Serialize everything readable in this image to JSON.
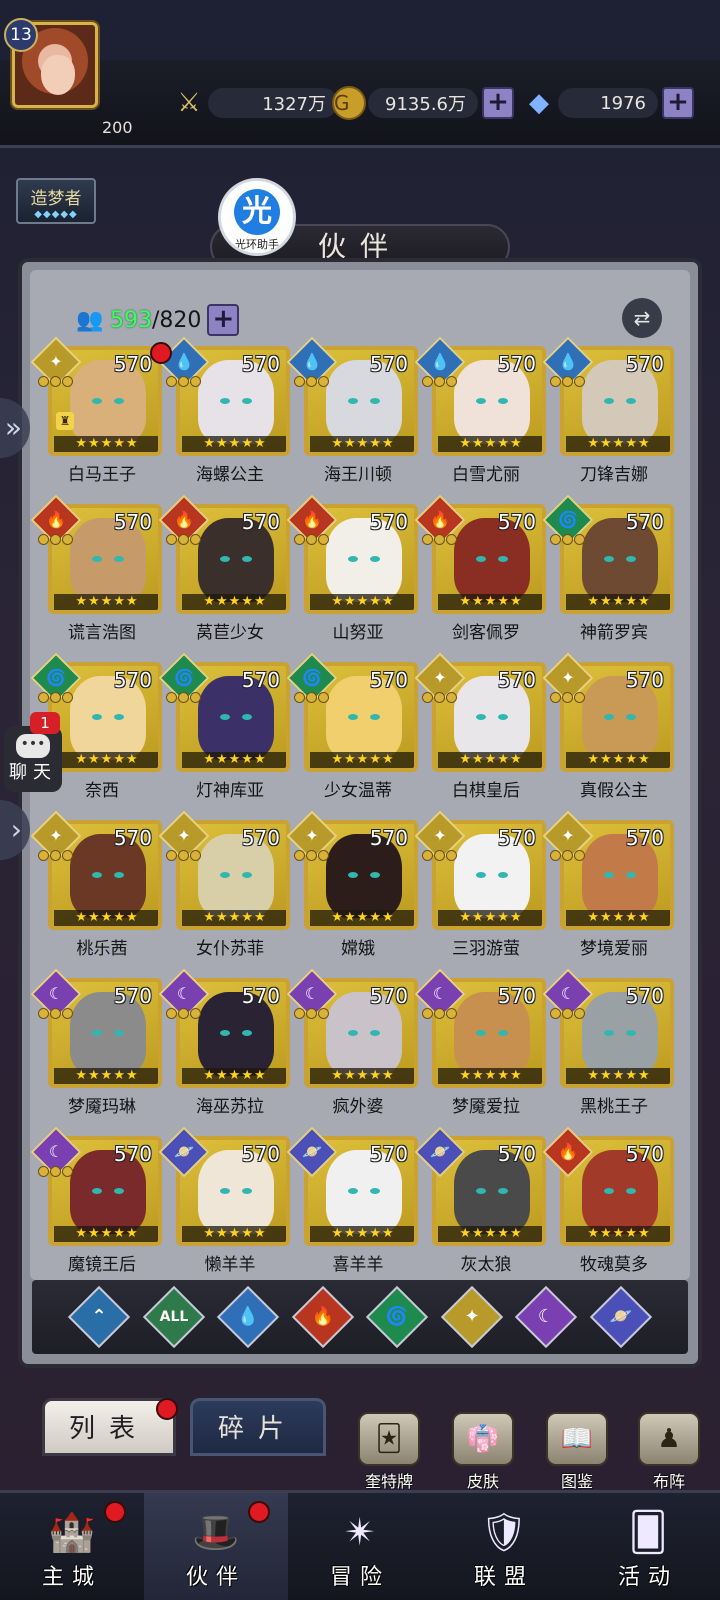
{
  "player": {
    "level": "13",
    "sub_value": "200",
    "rank_title": "造梦者",
    "rank_stars": "◆◆◆◆◆"
  },
  "resources": {
    "power": {
      "icon": "sword-icon",
      "value": "1327万"
    },
    "gold": {
      "icon": "gold-coin-icon",
      "value": "9135.6万"
    },
    "diamond": {
      "icon": "diamond-icon",
      "value": "1976"
    },
    "plus_label": "+"
  },
  "helper": {
    "icon_text": "光",
    "label": "光环助手"
  },
  "panel": {
    "title": "伙伴",
    "count_current": "593",
    "count_separator": "/",
    "count_max": "820",
    "plus_label": "+"
  },
  "heroes": [
    {
      "name": "白马王子",
      "level": "570",
      "element": "light",
      "stars": "★★★★★",
      "dots": 3,
      "red_dot": true,
      "lock": true
    },
    {
      "name": "海螺公主",
      "level": "570",
      "element": "water",
      "stars": "★★★★★",
      "dots": 3
    },
    {
      "name": "海王川顿",
      "level": "570",
      "element": "water",
      "stars": "★★★★★",
      "dots": 3
    },
    {
      "name": "白雪尤丽",
      "level": "570",
      "element": "water",
      "stars": "★★★★★",
      "dots": 3
    },
    {
      "name": "刀锋吉娜",
      "level": "570",
      "element": "water",
      "stars": "★★★★★",
      "dots": 3
    },
    {
      "name": "谎言浩图",
      "level": "570",
      "element": "fire",
      "stars": "★★★★★",
      "dots": 3
    },
    {
      "name": "莴苣少女",
      "level": "570",
      "element": "fire",
      "stars": "★★★★★",
      "dots": 3
    },
    {
      "name": "山努亚",
      "level": "570",
      "element": "fire",
      "stars": "★★★★★",
      "dots": 3
    },
    {
      "name": "剑客佩罗",
      "level": "570",
      "element": "fire",
      "stars": "★★★★★",
      "dots": 3
    },
    {
      "name": "神箭罗宾",
      "level": "570",
      "element": "wind",
      "stars": "★★★★★",
      "dots": 3
    },
    {
      "name": "奈西",
      "level": "570",
      "element": "wind",
      "stars": "★★★★★",
      "dots": 3
    },
    {
      "name": "灯神库亚",
      "level": "570",
      "element": "wind",
      "stars": "★★★★★",
      "dots": 3
    },
    {
      "name": "少女温蒂",
      "level": "570",
      "element": "wind",
      "stars": "★★★★★",
      "dots": 3
    },
    {
      "name": "白棋皇后",
      "level": "570",
      "element": "light",
      "stars": "★★★★★",
      "dots": 3
    },
    {
      "name": "真假公主",
      "level": "570",
      "element": "light",
      "stars": "★★★★★",
      "dots": 3
    },
    {
      "name": "桃乐茜",
      "level": "570",
      "element": "light",
      "stars": "★★★★★",
      "dots": 3
    },
    {
      "name": "女仆苏菲",
      "level": "570",
      "element": "light",
      "stars": "★★★★★",
      "dots": 3
    },
    {
      "name": "嫦娥",
      "level": "570",
      "element": "light",
      "stars": "★★★★★",
      "dots": 3
    },
    {
      "name": "三羽游萤",
      "level": "570",
      "element": "light",
      "stars": "★★★★★",
      "dots": 3
    },
    {
      "name": "梦境爱丽",
      "level": "570",
      "element": "light",
      "stars": "★★★★★",
      "dots": 3
    },
    {
      "name": "梦魇玛琳",
      "level": "570",
      "element": "dark",
      "stars": "★★★★★",
      "dots": 3
    },
    {
      "name": "海巫苏拉",
      "level": "570",
      "element": "dark",
      "stars": "★★★★★",
      "dots": 3
    },
    {
      "name": "疯外婆",
      "level": "570",
      "element": "dark",
      "stars": "★★★★★",
      "dots": 3
    },
    {
      "name": "梦魇爱拉",
      "level": "570",
      "element": "dark",
      "stars": "★★★★★",
      "dots": 3
    },
    {
      "name": "黑桃王子",
      "level": "570",
      "element": "dark",
      "stars": "★★★★★",
      "dots": 3
    },
    {
      "name": "魔镜王后",
      "level": "570",
      "element": "dark",
      "stars": "★★★★★",
      "dots": 3
    },
    {
      "name": "懒羊羊",
      "level": "570",
      "element": "planet",
      "stars": "★★★★★",
      "dots": 0
    },
    {
      "name": "喜羊羊",
      "level": "570",
      "element": "planet",
      "stars": "★★★★★",
      "dots": 0
    },
    {
      "name": "灰太狼",
      "level": "570",
      "element": "planet",
      "stars": "★★★★★",
      "dots": 0
    },
    {
      "name": "牧魂莫多",
      "level": "570",
      "element": "fire",
      "stars": "★★★★★",
      "dots": 0
    }
  ],
  "element_styles": {
    "light": {
      "color": "#b89a2a",
      "glyph": "✦"
    },
    "water": {
      "color": "#2f6fb8",
      "glyph": "💧"
    },
    "fire": {
      "color": "#b8361f",
      "glyph": "🔥"
    },
    "wind": {
      "color": "#1f8a4e",
      "glyph": "🌀"
    },
    "dark": {
      "color": "#7a3fb0",
      "glyph": "☾"
    },
    "planet": {
      "color": "#4a50b8",
      "glyph": "🪐"
    }
  },
  "portrait_colors": [
    "#d9b07a",
    "#e7e1e8",
    "#d7d9de",
    "#f0e2d8",
    "#d4c9b8",
    "#c79a6a",
    "#3a2f2a",
    "#f1efe8",
    "#8a2d22",
    "#6e4a33",
    "#f0d69a",
    "#3b3168",
    "#f1cf6c",
    "#e9e6ea",
    "#c99a55",
    "#6a3825",
    "#d8cfa8",
    "#2c1d1a",
    "#f2f2f2",
    "#c27b48",
    "#8b8b8b",
    "#2a2333",
    "#c9c3c9",
    "#c8904e",
    "#9aa1a4",
    "#7a2a2a",
    "#efe6d7",
    "#f0f0f0",
    "#4a4a4a",
    "#a23a2a"
  ],
  "filters": [
    {
      "name": "filter-special",
      "label": "⌃",
      "color": "#2a6ea8"
    },
    {
      "name": "filter-all",
      "label": "ALL",
      "color": "#2f7a4a"
    },
    {
      "name": "filter-water",
      "label": "💧",
      "color": "#2f6fb8"
    },
    {
      "name": "filter-fire",
      "label": "🔥",
      "color": "#b8361f"
    },
    {
      "name": "filter-wind",
      "label": "🌀",
      "color": "#1f8a4e"
    },
    {
      "name": "filter-light",
      "label": "✦",
      "color": "#b89a2a"
    },
    {
      "name": "filter-dark",
      "label": "☾",
      "color": "#7a3fb0"
    },
    {
      "name": "filter-planet",
      "label": "🪐",
      "color": "#4a50b8"
    }
  ],
  "side": {
    "chat_label": "聊天",
    "chat_badge": "1",
    "arrow_label": "»",
    "arrow2_label": "›"
  },
  "subtabs": {
    "list": "列表",
    "fragments": "碎片"
  },
  "functions": [
    {
      "name": "奎特牌",
      "icon": "card-icon",
      "glyph": "🃏"
    },
    {
      "name": "皮肤",
      "icon": "costume-icon",
      "glyph": "👘"
    },
    {
      "name": "图鉴",
      "icon": "album-icon",
      "glyph": "📖"
    },
    {
      "name": "布阵",
      "icon": "formation-icon",
      "glyph": "♟"
    }
  ],
  "nav": [
    {
      "label": "主城",
      "icon": "castle-icon",
      "glyph": "🏰",
      "red_dot": true,
      "active": false
    },
    {
      "label": "伙伴",
      "icon": "witch-hat-icon",
      "glyph": "🎩",
      "red_dot": true,
      "active": true
    },
    {
      "label": "冒险",
      "icon": "compass-icon",
      "glyph": "✴",
      "red_dot": false,
      "active": false
    },
    {
      "label": "联盟",
      "icon": "shield-icon",
      "glyph": "🛡",
      "red_dot": false,
      "active": false
    },
    {
      "label": "活动",
      "icon": "cards-icon",
      "glyph": "🂠",
      "red_dot": false,
      "active": false
    }
  ]
}
